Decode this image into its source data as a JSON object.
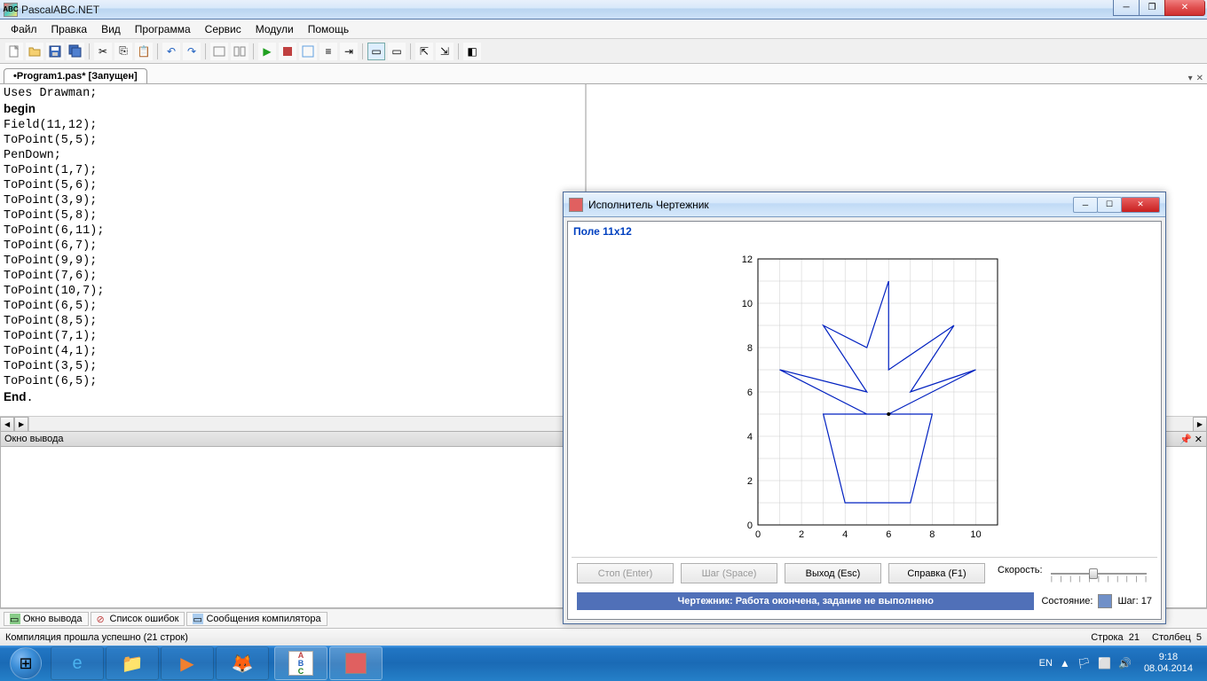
{
  "window": {
    "title": "PascalABC.NET"
  },
  "menu": [
    "Файл",
    "Правка",
    "Вид",
    "Программа",
    "Сервис",
    "Модули",
    "Помощь"
  ],
  "tab": {
    "label": "•Program1.pas* [Запущен]"
  },
  "code_lines": [
    {
      "t": "Uses ",
      "b": false
    },
    {
      "t": "Drawman;",
      "nl": true
    },
    {
      "t": "begin",
      "b": true,
      "nl": true
    },
    {
      "t": "Field(11,12);",
      "nl": true
    },
    {
      "t": "ToPoint(5,5);",
      "nl": true
    },
    {
      "t": "PenDown;",
      "nl": true
    },
    {
      "t": "ToPoint(1,7);",
      "nl": true
    },
    {
      "t": "ToPoint(5,6);",
      "nl": true
    },
    {
      "t": "ToPoint(3,9);",
      "nl": true
    },
    {
      "t": "ToPoint(5,8);",
      "nl": true
    },
    {
      "t": "ToPoint(6,11);",
      "nl": true
    },
    {
      "t": "ToPoint(6,7);",
      "nl": true
    },
    {
      "t": "ToPoint(9,9);",
      "nl": true
    },
    {
      "t": "ToPoint(7,6);",
      "nl": true
    },
    {
      "t": "ToPoint(10,7);",
      "nl": true
    },
    {
      "t": "ToPoint(6,5);",
      "nl": true
    },
    {
      "t": "ToPoint(8,5);",
      "nl": true
    },
    {
      "t": "ToPoint(7,1);",
      "nl": true
    },
    {
      "t": "ToPoint(4,1);",
      "nl": true
    },
    {
      "t": "ToPoint(3,5);",
      "nl": true
    },
    {
      "t": "ToPoint(6,5);",
      "nl": true
    },
    {
      "t": "End",
      "b": true
    },
    {
      "t": ".",
      "nl": true
    }
  ],
  "output_title": "Окно вывода",
  "bottom_tabs": [
    "Окно вывода",
    "Список ошибок",
    "Сообщения компилятора"
  ],
  "status": {
    "compile": "Компиляция прошла успешно (21 строк)",
    "line_lbl": "Строка",
    "line": "21",
    "col_lbl": "Столбец",
    "col": "5"
  },
  "child": {
    "title": "Исполнитель Чертежник",
    "field_label": "Поле 11x12",
    "buttons": {
      "stop": "Стоп (Enter)",
      "step": "Шаг (Space)",
      "exit": "Выход (Esc)",
      "help": "Справка (F1)"
    },
    "speed_label": "Скорость:",
    "state_label": "Состояние:",
    "step_label": "Шаг: 17",
    "status_text": "Чертежник: Работа окончена, задание не выполнено"
  },
  "chart_data": {
    "type": "line",
    "title": "",
    "xlabel": "",
    "ylabel": "",
    "xlim": [
      0,
      11
    ],
    "ylim": [
      0,
      12
    ],
    "xticks": [
      0,
      2,
      4,
      6,
      8,
      10
    ],
    "yticks": [
      0,
      2,
      4,
      6,
      8,
      10,
      12
    ],
    "series": [
      {
        "name": "path",
        "points": [
          [
            5,
            5
          ],
          [
            1,
            7
          ],
          [
            5,
            6
          ],
          [
            3,
            9
          ],
          [
            5,
            8
          ],
          [
            6,
            11
          ],
          [
            6,
            7
          ],
          [
            9,
            9
          ],
          [
            7,
            6
          ],
          [
            10,
            7
          ],
          [
            6,
            5
          ],
          [
            8,
            5
          ],
          [
            7,
            1
          ],
          [
            4,
            1
          ],
          [
            3,
            5
          ],
          [
            6,
            5
          ]
        ]
      }
    ]
  },
  "taskbar": {
    "lang": "EN",
    "time": "9:18",
    "date": "08.04.2014"
  }
}
